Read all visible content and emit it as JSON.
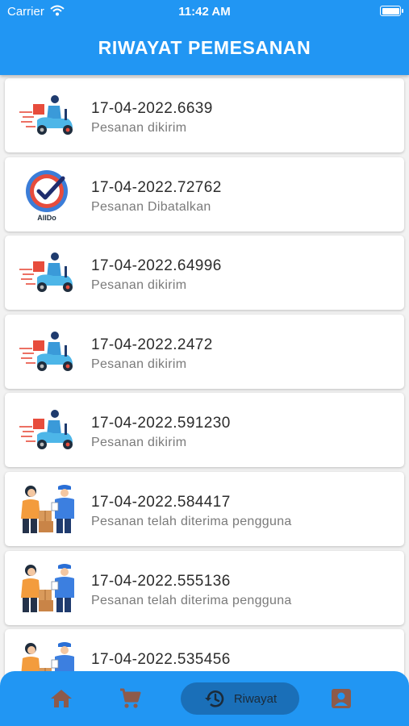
{
  "status_bar": {
    "carrier": "Carrier",
    "time": "11:42 AM"
  },
  "header": {
    "title": "RIWAYAT PEMESANAN"
  },
  "orders": [
    {
      "id": "17-04-2022.6639",
      "status": "Pesanan dikirim",
      "icon": "delivery-scooter"
    },
    {
      "id": "17-04-2022.72762",
      "status": "Pesanan Dibatalkan",
      "icon": "alldo-logo",
      "logo_text": "AllDo"
    },
    {
      "id": "17-04-2022.64996",
      "status": "Pesanan dikirim",
      "icon": "delivery-scooter"
    },
    {
      "id": "17-04-2022.2472",
      "status": "Pesanan dikirim",
      "icon": "delivery-scooter"
    },
    {
      "id": "17-04-2022.591230",
      "status": "Pesanan dikirim",
      "icon": "delivery-scooter"
    },
    {
      "id": "17-04-2022.584417",
      "status": "Pesanan telah diterima pengguna",
      "icon": "package-handover"
    },
    {
      "id": "17-04-2022.555136",
      "status": "Pesanan telah diterima pengguna",
      "icon": "package-handover"
    },
    {
      "id": "17-04-2022.535456",
      "status": "",
      "icon": "package-handover"
    }
  ],
  "bottom_nav": {
    "items": [
      {
        "icon": "home-icon"
      },
      {
        "icon": "cart-icon"
      },
      {
        "icon": "history-icon",
        "label": "Riwayat",
        "active": true
      },
      {
        "icon": "profile-icon"
      }
    ]
  },
  "colors": {
    "primary": "#2196f3",
    "nav_active_bg": "#1a6fb8",
    "nav_icon": "#8d5a4a",
    "card_bg": "#ffffff",
    "page_bg": "#f2f2f2"
  }
}
